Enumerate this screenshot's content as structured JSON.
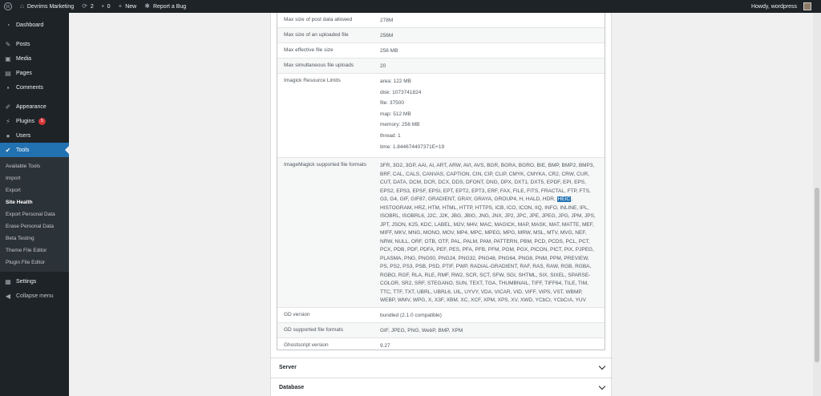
{
  "admin_bar": {
    "site_name": "Devrims Marketing",
    "updates_count": "2",
    "comments_count": "0",
    "new_label": "New",
    "report_bug_label": "Report a Bug",
    "howdy": "Howdy, wordpress"
  },
  "sidebar": {
    "dashboard": "Dashboard",
    "posts": "Posts",
    "media": "Media",
    "pages": "Pages",
    "comments": "Comments",
    "appearance": "Appearance",
    "plugins": "Plugins",
    "plugins_badge": "5",
    "users": "Users",
    "tools": "Tools",
    "sub": {
      "available_tools": "Available Tools",
      "import": "Import",
      "export": "Export",
      "site_health": "Site Health",
      "export_personal_data": "Export Personal Data",
      "erase_personal_data": "Erase Personal Data",
      "beta_testing": "Beta Testing",
      "theme_file_editor": "Theme File Editor",
      "plugin_file_editor": "Plugin File Editor"
    },
    "settings": "Settings",
    "collapse": "Collapse menu"
  },
  "table": {
    "rows": [
      {
        "label": "Max size of post data allowed",
        "value": "278M"
      },
      {
        "label": "Max size of an uploaded file",
        "value": "256M"
      },
      {
        "label": "Max effective file size",
        "value": "256 MB"
      },
      {
        "label": "Max simultaneous file uploads",
        "value": "20"
      }
    ],
    "imagick_label": "Imagick Resource Limits",
    "imagick_lines": [
      "area: 122 MB",
      "disk: 1073741824",
      "file: 37500",
      "map: 512 MB",
      "memory: 256 MB",
      "thread: 1",
      "time: 1.844674407371E+19"
    ],
    "formats_label": "ImageMagick supported file formats",
    "formats_before": "3FR, 3G2, 3GP, AAI, AI, ART, ARW, AVI, AVS, BGR, BGRA, BGRO, BIE, BMP, BMP2, BMP3, BRF, CAL, CALS, CANVAS, CAPTION, CIN, CIP, CLIP, CMYK, CMYKA, CR2, CRW, CUR, CUT, DATA, DCM, DCR, DCX, DDS, DFONT, DNG, DPX, DXT1, DXT5, EPDF, EPI, EPS, EPS2, EPS3, EPSF, EPSI, EPT, EPT2, EPT3, ERF, FAX, FILE, FITS, FRACTAL, FTP, FTS, G3, G4, GIF, GIF87, GRADIENT, GRAY, GRAYA, GROUP4, H, HALD, HDR, ",
    "formats_highlight": "HEIC",
    "formats_after": ", HISTOGRAM, HRZ, HTM, HTML, HTTP, HTTPS, ICB, ICO, ICON, IIQ, INFO, INLINE, IPL, ISOBRL, ISOBRL6, J2C, J2K, JBG, JBIG, JNG, JNX, JP2, JPC, JPE, JPEG, JPG, JPM, JPS, JPT, JSON, K25, KDC, LABEL, M2V, M4V, MAC, MAGICK, MAP, MASK, MAT, MATTE, MEF, MIFF, MKV, MNG, MONO, MOV, MP4, MPC, MPEG, MPG, MRW, MSL, MTV, MVG, NEF, NRW, NULL, ORF, OTB, OTF, PAL, PALM, PAM, PATTERN, PBM, PCD, PCDS, PCL, PCT, PCX, PDB, PDF, PDFA, PEF, PES, PFA, PFB, PFM, PGM, PGX, PICON, PICT, PIX, PJPEG, PLASMA, PNG, PNG00, PNG24, PNG32, PNG48, PNG64, PNG8, PNM, PPM, PREVIEW, PS, PS2, PS3, PSB, PSD, PTIF, PWP, RADIAL-GRADIENT, RAF, RAS, RAW, RGB, RGBA, RGBO, RGF, RLA, RLE, RMF, RW2, SCR, SCT, SFW, SGI, SHTML, SIX, SIXEL, SPARSE-COLOR, SR2, SRF, STEGANO, SUN, TEXT, TGA, THUMBNAIL, TIFF, TIFF64, TILE, TIM, TTC, TTF, TXT, UBRL, UBRL6, UIL, UYVY, VDA, VICAR, VID, VIFF, VIPS, VST, WBMP, WEBP, WMV, WPG, X, X3F, XBM, XC, XCF, XPM, XPS, XV, XWD, YCbCr, YCbCrA, YUV",
    "gd_rows": [
      {
        "label": "GD version",
        "value": "bundled (2.1.0 compatible)"
      },
      {
        "label": "GD supported file formats",
        "value": "GIF, JPEG, PNG, WebP, BMP, XPM"
      },
      {
        "label": "Ghostscript version",
        "value": "9.27"
      }
    ]
  },
  "accordions": {
    "server": "Server",
    "database": "Database"
  }
}
